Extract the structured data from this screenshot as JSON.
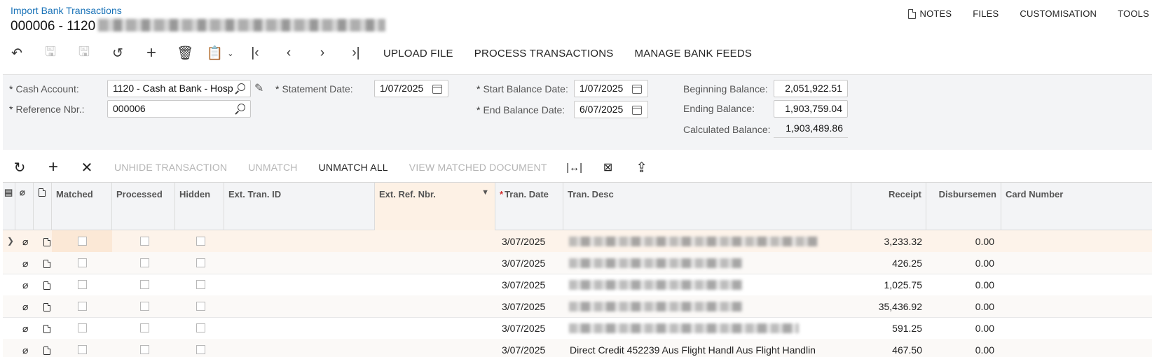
{
  "breadcrumb": "Import Bank Transactions",
  "title": "000006 - 1120",
  "toplinks": [
    {
      "label": "NOTES",
      "icon": "notes-icon"
    },
    {
      "label": "FILES"
    },
    {
      "label": "CUSTOMISATION"
    },
    {
      "label": "TOOLS"
    }
  ],
  "toolbar": {
    "icons": [
      "undo-back-icon",
      "save-close-icon",
      "save-icon",
      "cancel-icon",
      "add-icon",
      "delete-icon",
      "copy-paste-icon",
      "first-record-icon",
      "previous-record-icon",
      "next-record-icon",
      "last-record-icon"
    ],
    "upload_file": "UPLOAD FILE",
    "process_transactions": "PROCESS TRANSACTIONS",
    "manage_bank_feeds": "MANAGE BANK FEEDS"
  },
  "form": {
    "cash_account_label": "Cash Account:",
    "cash_account_value": "1120 - Cash at Bank - Hosp",
    "reference_nbr_label": "Reference Nbr.:",
    "reference_nbr_value": "000006",
    "statement_date_label": "Statement Date:",
    "statement_date_value": "1/07/2025",
    "start_balance_date_label": "Start Balance Date:",
    "start_balance_date_value": "1/07/2025",
    "end_balance_date_label": "End Balance Date:",
    "end_balance_date_value": "6/07/2025",
    "beginning_balance_label": "Beginning Balance:",
    "beginning_balance_value": "2,051,922.51",
    "ending_balance_label": "Ending Balance:",
    "ending_balance_value": "1,903,759.04",
    "calculated_balance_label": "Calculated Balance:",
    "calculated_balance_value": "1,903,489.86"
  },
  "grid_toolbar": {
    "unhide": "UNHIDE TRANSACTION",
    "unmatch": "UNMATCH",
    "unmatch_all": "UNMATCH ALL",
    "view_matched": "VIEW MATCHED DOCUMENT"
  },
  "columns": {
    "matched": "Matched",
    "processed": "Processed",
    "hidden": "Hidden",
    "ext_tran_id": "Ext. Tran. ID",
    "ext_ref_nbr": "Ext. Ref. Nbr.",
    "tran_date": "Tran. Date",
    "tran_desc": "Tran. Desc",
    "receipt": "Receipt",
    "disbursement": "Disbursemen",
    "card_number": "Card Number"
  },
  "rows": [
    {
      "tran_date": "3/07/2025",
      "tran_desc": "",
      "receipt": "3,233.32",
      "disbursement": "0.00"
    },
    {
      "tran_date": "3/07/2025",
      "tran_desc": "",
      "receipt": "426.25",
      "disbursement": "0.00"
    },
    {
      "tran_date": "3/07/2025",
      "tran_desc": "",
      "receipt": "1,025.75",
      "disbursement": "0.00"
    },
    {
      "tran_date": "3/07/2025",
      "tran_desc": "",
      "receipt": "35,436.92",
      "disbursement": "0.00"
    },
    {
      "tran_date": "3/07/2025",
      "tran_desc": "",
      "receipt": "591.25",
      "disbursement": "0.00"
    },
    {
      "tran_date": "3/07/2025",
      "tran_desc": "Direct Credit 452239 Aus Flight Handl Aus Flight Handlin",
      "receipt": "467.50",
      "disbursement": "0.00"
    }
  ]
}
